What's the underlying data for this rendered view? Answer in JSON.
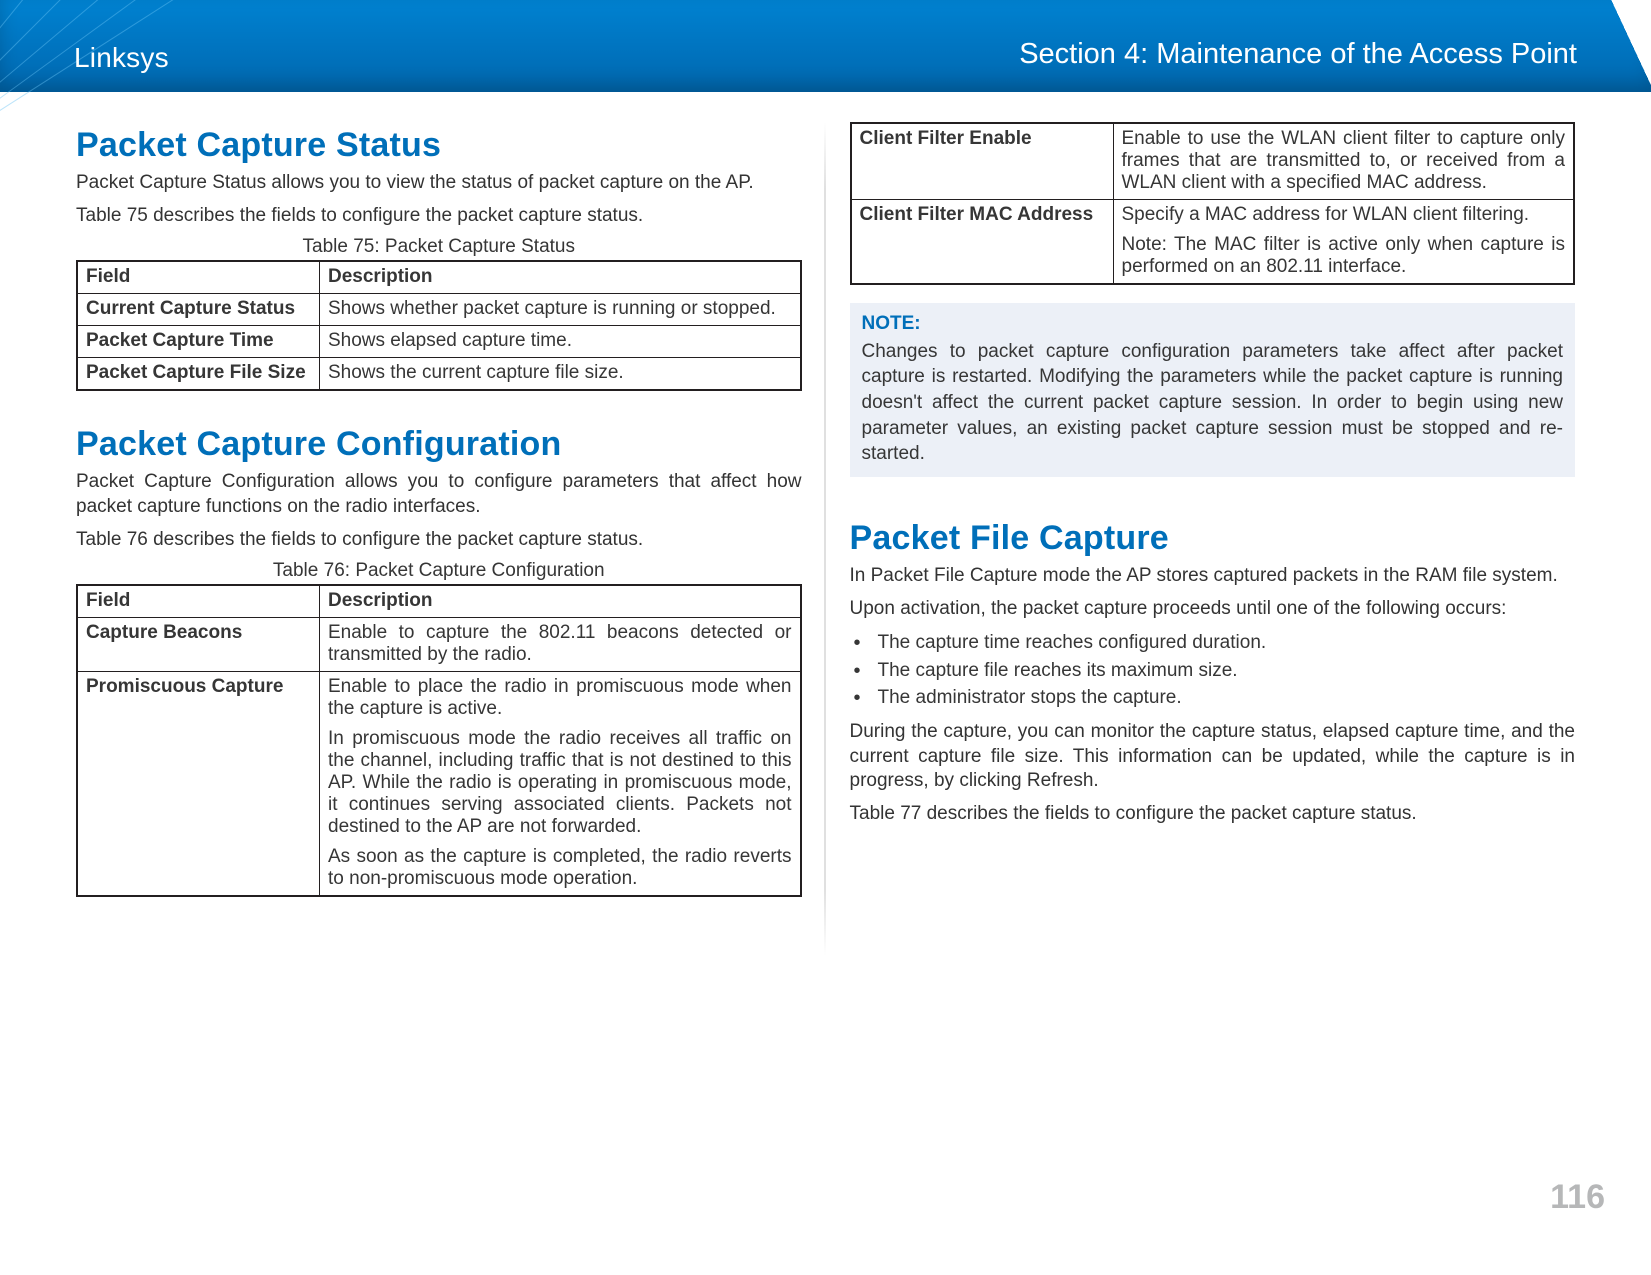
{
  "header": {
    "brand": "Linksys",
    "section": "Section 4: Maintenance of the Access Point"
  },
  "page_number": "116",
  "left": {
    "h_status": "Packet Capture Status",
    "status_intro": "Packet Capture Status allows you to view the status of packet capture on the AP.",
    "status_ref": "Table 75 describes the fields to configure the packet capture status.",
    "table75_caption": "Table 75: Packet Capture Status",
    "t75": {
      "head_field": "Field",
      "head_desc": "Description",
      "rows": [
        {
          "field": "Current Capture Status",
          "desc": "Shows whether packet capture is running or stopped."
        },
        {
          "field": "Packet Capture Time",
          "desc": "Shows elapsed capture time."
        },
        {
          "field": "Packet Capture File Size",
          "desc": "Shows the current capture file size."
        }
      ]
    },
    "h_config": "Packet Capture Configuration",
    "config_intro": "Packet Capture Configuration allows you to configure parameters that affect how packet capture functions on the radio interfaces.",
    "config_ref": "Table 76 describes the fields to configure the packet capture status.",
    "table76_caption": "Table 76: Packet Capture Configuration",
    "t76": {
      "head_field": "Field",
      "head_desc": "Description",
      "rows": [
        {
          "field": "Capture Beacons",
          "desc": [
            "Enable to capture the 802.11 beacons detected or transmitted by the radio."
          ]
        },
        {
          "field": "Promiscuous Capture",
          "desc": [
            "Enable to place the radio in promiscuous mode when the capture is active.",
            "In promiscuous mode the radio receives all traffic on the channel, including traffic that is not destined to this AP. While the radio is operating in promiscuous mode, it continues serving associated clients. Packets not destined to the AP are not forwarded.",
            "As soon as the capture is completed, the radio reverts to non-promiscuous mode operation."
          ]
        }
      ]
    }
  },
  "right": {
    "t76_cont": {
      "rows": [
        {
          "field": "Client Filter Enable",
          "desc": [
            "Enable to use the WLAN client filter to capture only frames that are transmitted to, or received from a WLAN client with a specified MAC address."
          ]
        },
        {
          "field": "Client Filter MAC Address",
          "desc": [
            "Specify a MAC address for WLAN client filtering.",
            "Note: The MAC filter is active only when capture is performed on an 802.11 interface."
          ]
        }
      ]
    },
    "note_label": "NOTE:",
    "note_body": "Changes to packet capture configuration parameters take affect after packet capture is restarted. Modifying the parameters while the packet capture is running doesn't affect the current packet capture session. In order to begin using new parameter values, an existing packet capture session must be stopped and re-started.",
    "h_file": "Packet File Capture",
    "file_intro": "In Packet File Capture mode the AP stores captured packets in the RAM file system.",
    "file_upon": "Upon activation, the packet capture proceeds until one of the following occurs:",
    "file_bullets": [
      "The capture time reaches configured duration.",
      "The capture file reaches its maximum size.",
      "The administrator stops the capture."
    ],
    "file_during": "During the capture, you can monitor the capture status, elapsed capture time, and the current capture file size. This information can be updated, while the capture is in progress, by clicking Refresh.",
    "file_ref": "Table 77 describes the fields to configure the packet capture status."
  }
}
